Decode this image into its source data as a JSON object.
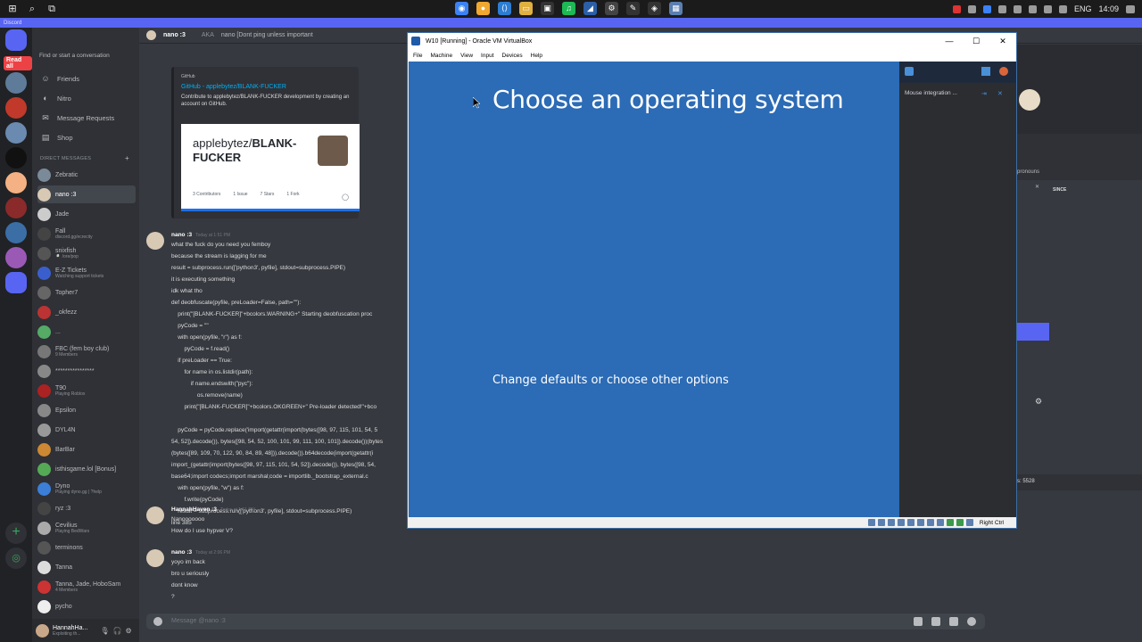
{
  "taskbar": {
    "clock": "14:09",
    "language": "ENG"
  },
  "discord": {
    "app_title": "Discord",
    "search_placeholder": "Find or start a conversation",
    "nav": [
      "Friends",
      "Nitro",
      "Message Requests",
      "Shop"
    ],
    "dm_header": "DIRECT MESSAGES",
    "dms": [
      {
        "name": "Zebratic",
        "sub": "",
        "color": "#7a8a99"
      },
      {
        "name": "nano :3",
        "sub": "",
        "color": "#d8c9b5"
      },
      {
        "name": "Jade",
        "sub": "",
        "color": "#ccc"
      },
      {
        "name": "Fall",
        "sub": "discord.gg/ecrecity",
        "color": "#444"
      },
      {
        "name": "snixfish",
        "sub": "🍳 /ore/pop",
        "color": "#555"
      },
      {
        "name": "E-Z Tickets",
        "sub": "Watching support tickets",
        "color": "#3a5fcd"
      },
      {
        "name": "Topher7",
        "sub": "",
        "color": "#666"
      },
      {
        "name": "_okfezz",
        "sub": "",
        "color": "#b33"
      },
      {
        "name": "...",
        "sub": "",
        "color": "#5a6"
      },
      {
        "name": "FBC (fem boy club)",
        "sub": "9 Members",
        "color": "#777"
      },
      {
        "name": "****************",
        "sub": "",
        "color": "#888"
      },
      {
        "name": "T90",
        "sub": "Playing Roblox",
        "color": "#a22"
      },
      {
        "name": "Epsilon",
        "sub": "",
        "color": "#888"
      },
      {
        "name": "DYL4N",
        "sub": "",
        "color": "#999"
      },
      {
        "name": "BarBar",
        "sub": "",
        "color": "#c83"
      },
      {
        "name": "isthisgame.lol [Bonus]",
        "sub": "",
        "color": "#5a5"
      },
      {
        "name": "Dyno",
        "sub": "Playing dyno.gg | ?help",
        "color": "#3b7fd8"
      },
      {
        "name": "ryz :3",
        "sub": "",
        "color": "#444"
      },
      {
        "name": "Cevilius",
        "sub": "Playing BedWars",
        "color": "#aaa"
      },
      {
        "name": "terminons",
        "sub": "",
        "color": "#555"
      },
      {
        "name": "Tanna",
        "sub": "",
        "color": "#ddd"
      },
      {
        "name": "Tanna, Jade, HoboSam",
        "sub": "4 Members",
        "color": "#c33"
      },
      {
        "name": "pycho",
        "sub": "",
        "color": "#eee"
      }
    ],
    "user_panel": {
      "name": "HannahHa...",
      "status": "Exploiting th..."
    },
    "chat_header": {
      "name": "nano :3",
      "aka_label": "AKA",
      "aka": "nano [Dont ping unless important"
    },
    "embed": {
      "provider": "GitHub",
      "title": "GitHub - applebytez/BLANK-FUCKER",
      "description": "Contribute to applebytez/BLANK-FUCKER development by creating an account on GitHub.",
      "card_title_owner": "applebytez/",
      "card_title_repo": "BLANK-FUCKER",
      "stats": [
        "3 Contributors",
        "1 Issue",
        "7 Stars",
        "1 Fork"
      ]
    },
    "messages": [
      {
        "author": "nano :3",
        "time": "Today at 1:51 PM",
        "lines": [
          "what the fuck do you need you femboy",
          "because the stream is lagging for me",
          "result = subprocess.run(['python3', pyfile], stdout=subprocess.PIPE)",
          "it is executing something",
          "idk what tho",
          "def deobfuscate(pyfile, preLoader=False, path=\"\"):",
          "    print(\"[BLANK-FUCKER]\"+bcolors.WARNING+\" Starting deobfuscation proc",
          "    pyCode = \"\"",
          "    with open(pyfile, \"r\") as f:",
          "        pyCode = f.read()",
          "    if preLoader == True:",
          "        for name in os.listdir(path):",
          "            if name.endswith(\"pyc\"):",
          "                os.remove(name)",
          "        print(\"[BLANK-FUCKER]\"+bcolors.OKGREEN+\" Pre-loader detected!\"+bco",
          "",
          "    pyCode = pyCode.replace('import(getattr(import(bytes([98, 97, 115, 101, 54, 5",
          "54, 52]).decode()), bytes([98, 54, 52, 100, 101, 99, 111, 100, 101]).decode())(bytes",
          "(bytes([89, 109, 70, 122, 90, 84, 89, 48])).decode()).b64decode(import(getattr(i",
          "import_(getattr(import(bytes([98, 97, 115, 101, 54, 52]).decode()), bytes([98, 54,",
          "base64;import codecs;import marshal;code = importlib._bootstrap_external.c",
          "    with open(pyfile, \"w\") as f:",
          "        f.write(pyCode)",
          "    result = subprocess.run(['python3', pyfile], stdout=subprocess.PIPE)",
          "line 385"
        ]
      },
      {
        "author": "HannahHaven :3",
        "time": "Today at 1:51 PM",
        "lines": [
          "Nanooooooo",
          "How do I use hypver V?"
        ]
      },
      {
        "author": "nano :3",
        "time": "Today at 2:06 PM",
        "lines": [
          "yoyo im back",
          "bro u seriously",
          "dont know",
          "?"
        ]
      }
    ],
    "message_placeholder": "Message @nano :3",
    "right_panel": {
      "pronouns": "pronouns",
      "since": "SINCE",
      "counter": "s: 5528"
    }
  },
  "vbox": {
    "title": "W10 [Running] - Oracle VM VirtualBox",
    "menu": [
      "File",
      "Machine",
      "View",
      "Input",
      "Devices",
      "Help"
    ],
    "screen_title": "Choose an operating system",
    "screen_option": "Change defaults or choose other options",
    "notice": "Mouse integration ...",
    "host_key": "Right Ctrl",
    "colors": {
      "screen": "#2c6bb5",
      "titlebar": "#ffffff"
    }
  }
}
